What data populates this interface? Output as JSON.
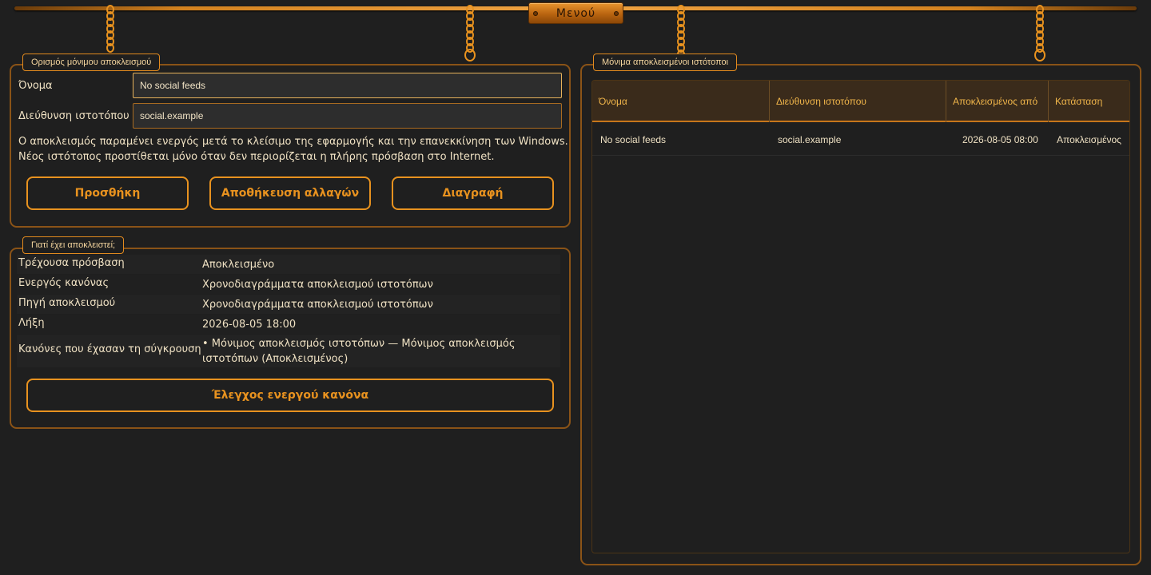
{
  "menu": {
    "label": "Μενού"
  },
  "block_form": {
    "legend": "Ορισμός μόνιμου αποκλεισμού",
    "name_label": "Όνομα",
    "name_value": "No social feeds",
    "address_label": "Διεύθυνση ιστοτόπου",
    "address_value": "social.example",
    "info_line1": "Ο αποκλεισμός παραμένει ενεργός μετά το κλείσιμο της εφαρμογής και την επανεκκίνηση των Windows.",
    "info_line2": "Νέος ιστότοπος προστίθεται μόνο όταν δεν περιορίζεται η πλήρης πρόσβαση στο Internet.",
    "add_button": "Προσθήκη",
    "save_button": "Αποθήκευση αλλαγών",
    "delete_button": "Διαγραφή"
  },
  "why_blocked": {
    "legend": "Γιατί έχει αποκλειστεί;",
    "rows": [
      {
        "key": "Τρέχουσα πρόσβαση",
        "value": "Αποκλεισμένο"
      },
      {
        "key": "Ενεργός κανόνας",
        "value": "Χρονοδιαγράμματα αποκλεισμού ιστοτόπων"
      },
      {
        "key": "Πηγή αποκλεισμού",
        "value": "Χρονοδιαγράμματα αποκλεισμού ιστοτόπων"
      },
      {
        "key": "Λήξη",
        "value": "2026-08-05 18:00"
      },
      {
        "key": "Κανόνες που έχασαν τη σύγκρουση",
        "value_line1": "• Μόνιμος αποκλεισμός ιστοτόπων — Μόνιμος αποκλεισμός",
        "value_line2": "ιστοτόπων (Αποκλεισμένος)"
      }
    ],
    "check_button": "Έλεγχος ενεργού κανόνα"
  },
  "blocked_sites": {
    "legend": "Μόνιμα αποκλεισμένοι ιστότοποι",
    "columns": [
      "Όνομα",
      "Διεύθυνση ιστοτόπου",
      "Αποκλεισμένος από",
      "Κατάσταση"
    ],
    "rows": [
      [
        "No social feeds",
        "social.example",
        "2026-08-05 08:00",
        "Αποκλεισμένος"
      ]
    ]
  },
  "colors": {
    "accent": "#e8921f",
    "background": "#1f1f1f",
    "text": "#efe1c3",
    "header_text": "#f0b54a"
  }
}
